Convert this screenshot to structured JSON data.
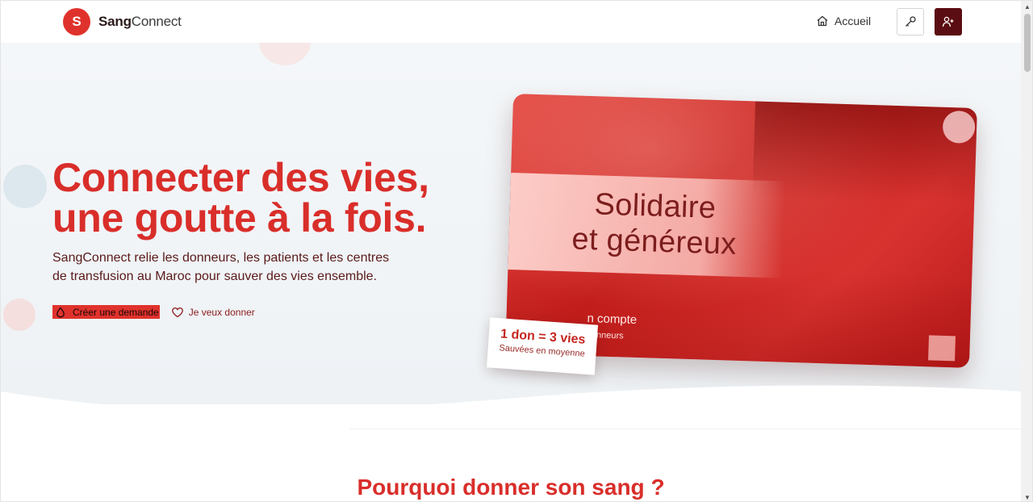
{
  "header": {
    "logo_letter": "S",
    "brand_part1": "Sang",
    "brand_part2": "Connect",
    "nav_home_label": "Accueil",
    "login_icon": "key-icon",
    "register_icon": "user-plus-icon"
  },
  "hero": {
    "title_line1": "Connecter des vies,",
    "title_line2": "une goutte à la fois.",
    "subtitle_line1": "SangConnect relie les donneurs, les patients et les centres",
    "subtitle_line2": "de transfusion au Maroc pour sauver des vies ensemble.",
    "cta_primary": "Créer une demande",
    "cta_secondary": "Je veux donner",
    "card": {
      "banner_line1": "Solidaire",
      "banner_line2": "et généreux",
      "title": "n compte",
      "subtitle": "communauté de donneurs"
    },
    "stat": {
      "main": "1 don = 3 vies",
      "sub": "Sauvées en moyenne"
    }
  },
  "section": {
    "title": "Pourquoi donner son sang ?"
  },
  "colors": {
    "brand_red": "#d92e2a",
    "dark_maroon": "#5a0d12"
  }
}
